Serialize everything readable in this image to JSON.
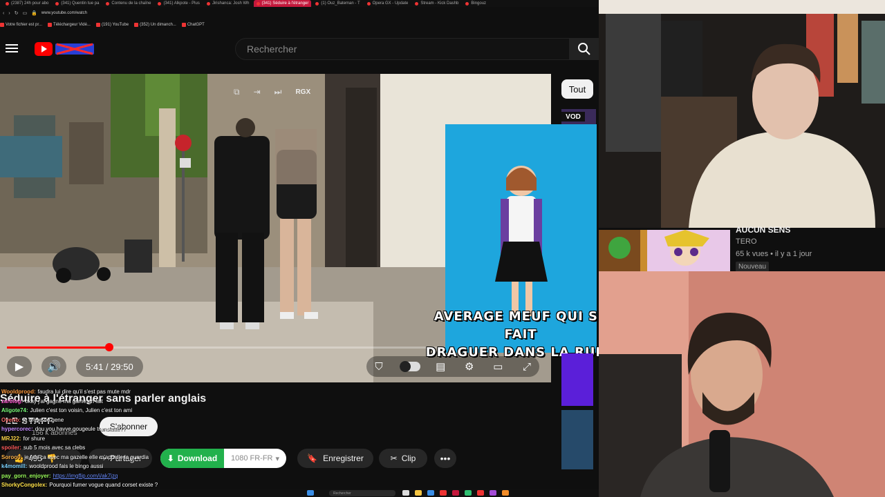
{
  "browser": {
    "tabs": [
      {
        "label": "(2387) 24h pour abo"
      },
      {
        "label": "(341) Quentin tue pa"
      },
      {
        "label": "Contenu de la chaîne"
      },
      {
        "label": "(341) Alkpote - Plus"
      },
      {
        "label": "Jirishanca: Josh Wh"
      },
      {
        "label": "(341) Séduire à l'étranger",
        "active": true
      },
      {
        "label": "(1) Ouz_Bateman - T"
      },
      {
        "label": "Opera GX - Update"
      },
      {
        "label": "Stream - Kick Dashb"
      },
      {
        "label": "Bingouz"
      }
    ],
    "url": "www.youtube.com/watch",
    "bookmarks": [
      {
        "label": "Votre fichier est pr..."
      },
      {
        "label": "Téléchargeur Vidé..."
      },
      {
        "label": "(191) YouTube"
      },
      {
        "label": "(352) Un dimanch..."
      },
      {
        "label": "ChatGPT"
      }
    ]
  },
  "header": {
    "search_placeholder": "Rechercher"
  },
  "player": {
    "overlay_label": "RGX",
    "time": "5:41 / 29:50",
    "progress": 0.19
  },
  "meme": {
    "caption_line1": "AVERAGE MEUF QUI SE FAIT",
    "caption_line2": "DRAGUER DANS LA RUE :"
  },
  "sidebar": {
    "chip_all": "Tout",
    "vod_badge": "VOD"
  },
  "recommendation": {
    "title": "AUCUN SENS",
    "channel": "TERO",
    "meta": "65 k vues • il y a 1 jour",
    "badge": "Nouveau"
  },
  "video": {
    "title": "Séduire à l'étranger sans parler anglais",
    "channel": "LE STAFF",
    "subscribers": "156 k abonnés",
    "subscribe_label": "S'abonner",
    "likes": "495",
    "share_label": "Partager",
    "download_label": "Download",
    "download_quality": "1080 FR-FR",
    "save_label": "Enregistrer",
    "clip_label": "Clip"
  },
  "chat": [
    {
      "user": "Wooldprood:",
      "color": "#ff9a3c",
      "text": "faudra lui dire qu'il s'est pas mute mdr"
    },
    {
      "user": "zarblog:",
      "color": "#ff5cd1",
      "text": "okay j'ai gagné ma game en fait"
    },
    {
      "user": "Aligote74:",
      "color": "#7dff7d",
      "text": "Julien c'est ton voisin, Julien c'est ton ami"
    },
    {
      "user": "Oyerlo:",
      "color": "#ff6b6b",
      "text": "je crève de gene"
    },
    {
      "user": "hypercorec:",
      "color": "#c58bff",
      "text": "dou you havve gougeule translatte??"
    },
    {
      "user": "MRJ22:",
      "color": "#ffd84a",
      "text": "for shure"
    },
    {
      "user": "spoiler:",
      "color": "#ff5c5c",
      "text": "sub 5 mois avec sa clebs"
    },
    {
      "user": "Soroo0:",
      "color": "#ffb347",
      "text": "je fais ça avec ma gazelle elle m'appelle la guardia"
    },
    {
      "user": "k4momill:",
      "color": "#7dd3ff",
      "text": "wooldprood fais le bingo aussi"
    },
    {
      "user": "pay_gorn_enjoyer:",
      "color": "#9cff5c",
      "text": "",
      "link": "https://imgflip.com/i/ak7jzq"
    },
    {
      "user": "ShorkyCongolex:",
      "color": "#ffe14a",
      "text": "Pourquoi fumer vogue quand corset existe ?"
    }
  ],
  "taskbar": {
    "search_label": "Rechercher"
  },
  "colors": {
    "accent_red": "#ff0000",
    "download_green": "#22b14c",
    "meme_blue": "#1ea6dd"
  },
  "icons": [
    "hamburger-icon",
    "youtube-logo-icon",
    "search-icon",
    "play-icon",
    "volume-icon",
    "miniplayer-icon",
    "settings-icon",
    "subtitles-icon",
    "fullscreen-icon",
    "share-icon",
    "download-arrow-icon",
    "bookmark-icon",
    "scissors-icon",
    "more-icon"
  ]
}
